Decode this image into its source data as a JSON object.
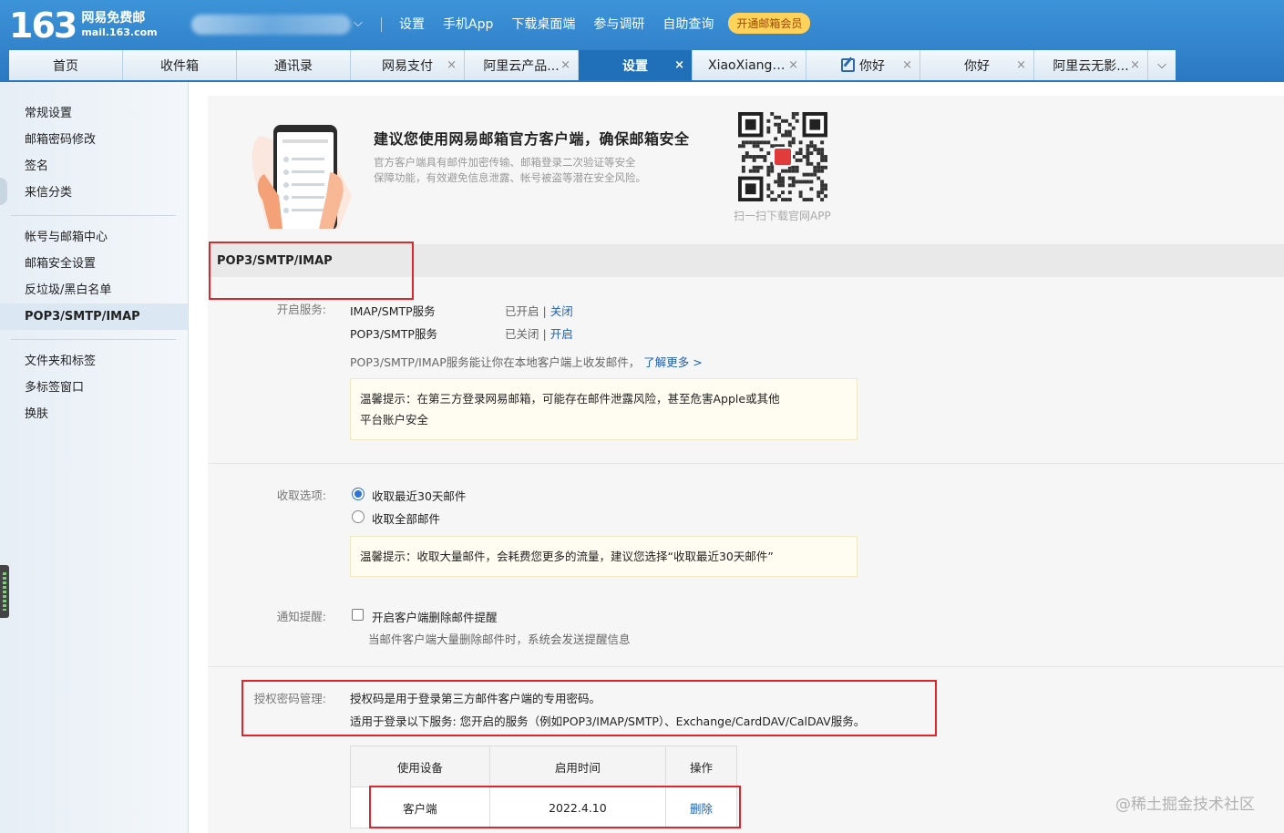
{
  "header": {
    "logo_number": "163",
    "logo_name": "网易免费邮",
    "logo_domain": "mail.163.com",
    "top_links": [
      "设置",
      "手机App",
      "下载桌面端",
      "参与调研",
      "自助查询"
    ],
    "vip_badge": "开通邮箱会员"
  },
  "tabs": [
    {
      "label": "首页",
      "closable": false,
      "active": false
    },
    {
      "label": "收件箱",
      "closable": false,
      "active": false
    },
    {
      "label": "通讯录",
      "closable": false,
      "active": false
    },
    {
      "label": "网易支付",
      "closable": true,
      "active": false
    },
    {
      "label": "阿里云产品...",
      "closable": true,
      "active": false
    },
    {
      "label": "设置",
      "closable": true,
      "active": true
    },
    {
      "label": "XiaoXiangy...",
      "closable": true,
      "active": false
    },
    {
      "label": "你好",
      "closable": true,
      "active": false,
      "icon": "edit-icon"
    },
    {
      "label": "你好",
      "closable": true,
      "active": false
    },
    {
      "label": "阿里云无影...",
      "closable": true,
      "active": false
    }
  ],
  "tab_close_glyph": "×",
  "tab_more_glyph": "⌵",
  "sidebar": {
    "groups": [
      [
        "常规设置",
        "邮箱密码修改",
        "签名",
        "来信分类"
      ],
      [
        "帐号与邮箱中心",
        "邮箱安全设置",
        "反垃圾/黑白名单",
        "POP3/SMTP/IMAP"
      ],
      [
        "文件夹和标签",
        "多标签窗口",
        "换肤"
      ]
    ],
    "active": "POP3/SMTP/IMAP"
  },
  "promo": {
    "title": "建议您使用网易邮箱官方客户端，确保邮箱安全",
    "desc_line1": "官方客户端具有邮件加密传输、邮箱登录二次验证等安全",
    "desc_line2": "保障功能，有效避免信息泄露、帐号被盗等潜在安全风险。",
    "qr_caption": "扫一扫下载官网APP"
  },
  "section": {
    "title": "POP3/SMTP/IMAP"
  },
  "services": {
    "label": "开启服务:",
    "items": [
      {
        "name": "IMAP/SMTP服务",
        "status": "已开启",
        "sep": " | ",
        "action": "关闭"
      },
      {
        "name": "POP3/SMTP服务",
        "status": "已关闭",
        "sep": " | ",
        "action": "开启"
      }
    ],
    "note": "POP3/SMTP/IMAP服务能让你在本地客户端上收发邮件，",
    "learn_more": "了解更多 >",
    "tip_line1": "温馨提示：在第三方登录网易邮箱，可能存在邮件泄露风险，甚至危害Apple或其他",
    "tip_line2": "平台账户安全"
  },
  "fetch": {
    "label": "收取选项:",
    "option_recent": "收取最近30天邮件",
    "option_all": "收取全部邮件",
    "selected": "option_recent",
    "tip": "温馨提示：收取大量邮件，会耗费您更多的流量，建议您选择“收取最近30天邮件”"
  },
  "notify": {
    "label": "通知提醒:",
    "checkbox_label": "开启客户端删除邮件提醒",
    "checked": false,
    "desc": "当邮件客户端大量删除邮件时，系统会发送提醒信息"
  },
  "auth": {
    "label": "授权密码管理:",
    "line1": "授权码是用于登录第三方邮件客户端的专用密码。",
    "line2": "适用于登录以下服务: 您开启的服务（例如POP3/IMAP/SMTP）、Exchange/CardDAV/CalDAV服务。",
    "table": {
      "headers": [
        "使用设备",
        "启用时间",
        "操作"
      ],
      "rows": [
        {
          "device": "客户端",
          "time": "2022.4.10",
          "action": "删除"
        }
      ]
    }
  },
  "watermark": "@稀土掘金技术社区",
  "colors": {
    "header_blue": "#2a78c2",
    "active_tab": "#1f6fb9",
    "link": "#1e5fb4",
    "highlight_box": "#e0262c",
    "vip_badge": "#ffd25a"
  }
}
